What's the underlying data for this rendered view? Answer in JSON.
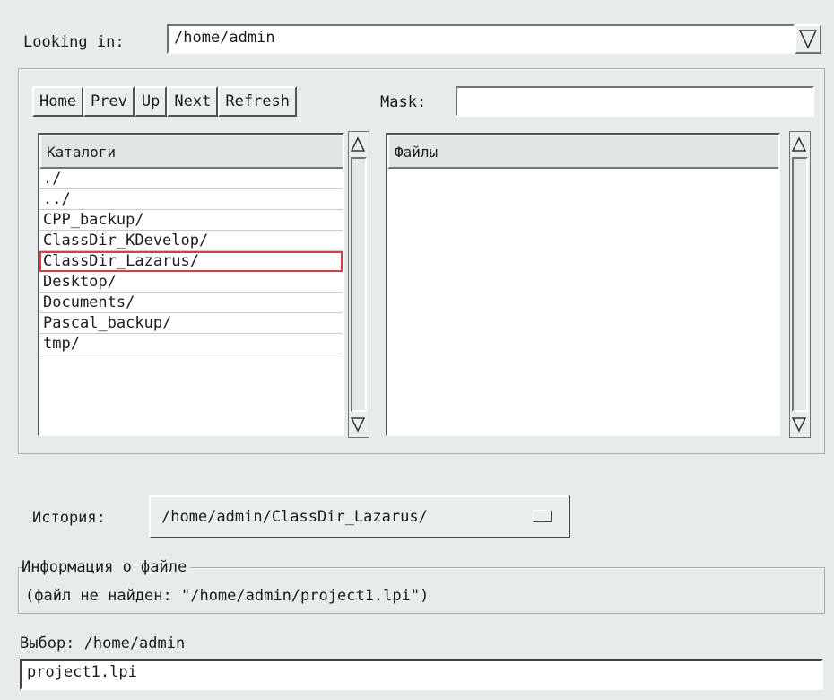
{
  "looking_in": {
    "label": "Looking in:",
    "value": "/home/admin"
  },
  "toolbar": {
    "buttons": [
      "Home",
      "Prev",
      "Up",
      "Next",
      "Refresh"
    ],
    "mask_label": "Mask:",
    "mask_value": ""
  },
  "dirs": {
    "header": "Каталоги",
    "items": [
      "./",
      "../",
      "CPP_backup/",
      "ClassDir_KDevelop/",
      "ClassDir_Lazarus/",
      "Desktop/",
      "Documents/",
      "Pascal_backup/",
      "tmp/"
    ],
    "selected": "ClassDir_Lazarus/"
  },
  "files": {
    "header": "Файлы",
    "items": []
  },
  "history": {
    "label": "История:",
    "value": "/home/admin/ClassDir_Lazarus/"
  },
  "file_info": {
    "title": "Информация о файле",
    "text": "(файл не найден: \"/home/admin/project1.lpi\")"
  },
  "selection": {
    "label": "Выбор: /home/admin",
    "value": "project1.lpi"
  },
  "colors": {
    "background": "#e6eceb",
    "selection_outline": "#d64045"
  }
}
